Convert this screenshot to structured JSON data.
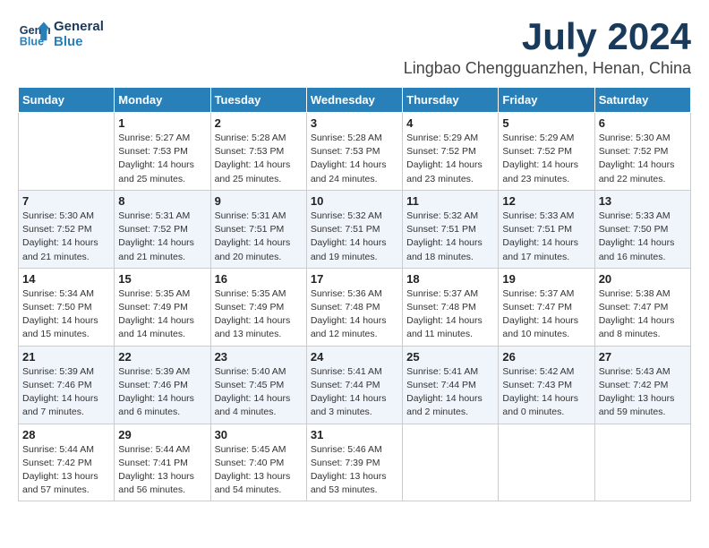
{
  "logo": {
    "text1": "General",
    "text2": "Blue"
  },
  "title": "July 2024",
  "location": "Lingbao Chengguanzhen, Henan, China",
  "weekdays": [
    "Sunday",
    "Monday",
    "Tuesday",
    "Wednesday",
    "Thursday",
    "Friday",
    "Saturday"
  ],
  "weeks": [
    [
      {
        "day": "",
        "info": ""
      },
      {
        "day": "1",
        "info": "Sunrise: 5:27 AM\nSunset: 7:53 PM\nDaylight: 14 hours\nand 25 minutes."
      },
      {
        "day": "2",
        "info": "Sunrise: 5:28 AM\nSunset: 7:53 PM\nDaylight: 14 hours\nand 25 minutes."
      },
      {
        "day": "3",
        "info": "Sunrise: 5:28 AM\nSunset: 7:53 PM\nDaylight: 14 hours\nand 24 minutes."
      },
      {
        "day": "4",
        "info": "Sunrise: 5:29 AM\nSunset: 7:52 PM\nDaylight: 14 hours\nand 23 minutes."
      },
      {
        "day": "5",
        "info": "Sunrise: 5:29 AM\nSunset: 7:52 PM\nDaylight: 14 hours\nand 23 minutes."
      },
      {
        "day": "6",
        "info": "Sunrise: 5:30 AM\nSunset: 7:52 PM\nDaylight: 14 hours\nand 22 minutes."
      }
    ],
    [
      {
        "day": "7",
        "info": "Sunrise: 5:30 AM\nSunset: 7:52 PM\nDaylight: 14 hours\nand 21 minutes."
      },
      {
        "day": "8",
        "info": "Sunrise: 5:31 AM\nSunset: 7:52 PM\nDaylight: 14 hours\nand 21 minutes."
      },
      {
        "day": "9",
        "info": "Sunrise: 5:31 AM\nSunset: 7:51 PM\nDaylight: 14 hours\nand 20 minutes."
      },
      {
        "day": "10",
        "info": "Sunrise: 5:32 AM\nSunset: 7:51 PM\nDaylight: 14 hours\nand 19 minutes."
      },
      {
        "day": "11",
        "info": "Sunrise: 5:32 AM\nSunset: 7:51 PM\nDaylight: 14 hours\nand 18 minutes."
      },
      {
        "day": "12",
        "info": "Sunrise: 5:33 AM\nSunset: 7:51 PM\nDaylight: 14 hours\nand 17 minutes."
      },
      {
        "day": "13",
        "info": "Sunrise: 5:33 AM\nSunset: 7:50 PM\nDaylight: 14 hours\nand 16 minutes."
      }
    ],
    [
      {
        "day": "14",
        "info": "Sunrise: 5:34 AM\nSunset: 7:50 PM\nDaylight: 14 hours\nand 15 minutes."
      },
      {
        "day": "15",
        "info": "Sunrise: 5:35 AM\nSunset: 7:49 PM\nDaylight: 14 hours\nand 14 minutes."
      },
      {
        "day": "16",
        "info": "Sunrise: 5:35 AM\nSunset: 7:49 PM\nDaylight: 14 hours\nand 13 minutes."
      },
      {
        "day": "17",
        "info": "Sunrise: 5:36 AM\nSunset: 7:48 PM\nDaylight: 14 hours\nand 12 minutes."
      },
      {
        "day": "18",
        "info": "Sunrise: 5:37 AM\nSunset: 7:48 PM\nDaylight: 14 hours\nand 11 minutes."
      },
      {
        "day": "19",
        "info": "Sunrise: 5:37 AM\nSunset: 7:47 PM\nDaylight: 14 hours\nand 10 minutes."
      },
      {
        "day": "20",
        "info": "Sunrise: 5:38 AM\nSunset: 7:47 PM\nDaylight: 14 hours\nand 8 minutes."
      }
    ],
    [
      {
        "day": "21",
        "info": "Sunrise: 5:39 AM\nSunset: 7:46 PM\nDaylight: 14 hours\nand 7 minutes."
      },
      {
        "day": "22",
        "info": "Sunrise: 5:39 AM\nSunset: 7:46 PM\nDaylight: 14 hours\nand 6 minutes."
      },
      {
        "day": "23",
        "info": "Sunrise: 5:40 AM\nSunset: 7:45 PM\nDaylight: 14 hours\nand 4 minutes."
      },
      {
        "day": "24",
        "info": "Sunrise: 5:41 AM\nSunset: 7:44 PM\nDaylight: 14 hours\nand 3 minutes."
      },
      {
        "day": "25",
        "info": "Sunrise: 5:41 AM\nSunset: 7:44 PM\nDaylight: 14 hours\nand 2 minutes."
      },
      {
        "day": "26",
        "info": "Sunrise: 5:42 AM\nSunset: 7:43 PM\nDaylight: 14 hours\nand 0 minutes."
      },
      {
        "day": "27",
        "info": "Sunrise: 5:43 AM\nSunset: 7:42 PM\nDaylight: 13 hours\nand 59 minutes."
      }
    ],
    [
      {
        "day": "28",
        "info": "Sunrise: 5:44 AM\nSunset: 7:42 PM\nDaylight: 13 hours\nand 57 minutes."
      },
      {
        "day": "29",
        "info": "Sunrise: 5:44 AM\nSunset: 7:41 PM\nDaylight: 13 hours\nand 56 minutes."
      },
      {
        "day": "30",
        "info": "Sunrise: 5:45 AM\nSunset: 7:40 PM\nDaylight: 13 hours\nand 54 minutes."
      },
      {
        "day": "31",
        "info": "Sunrise: 5:46 AM\nSunset: 7:39 PM\nDaylight: 13 hours\nand 53 minutes."
      },
      {
        "day": "",
        "info": ""
      },
      {
        "day": "",
        "info": ""
      },
      {
        "day": "",
        "info": ""
      }
    ]
  ]
}
